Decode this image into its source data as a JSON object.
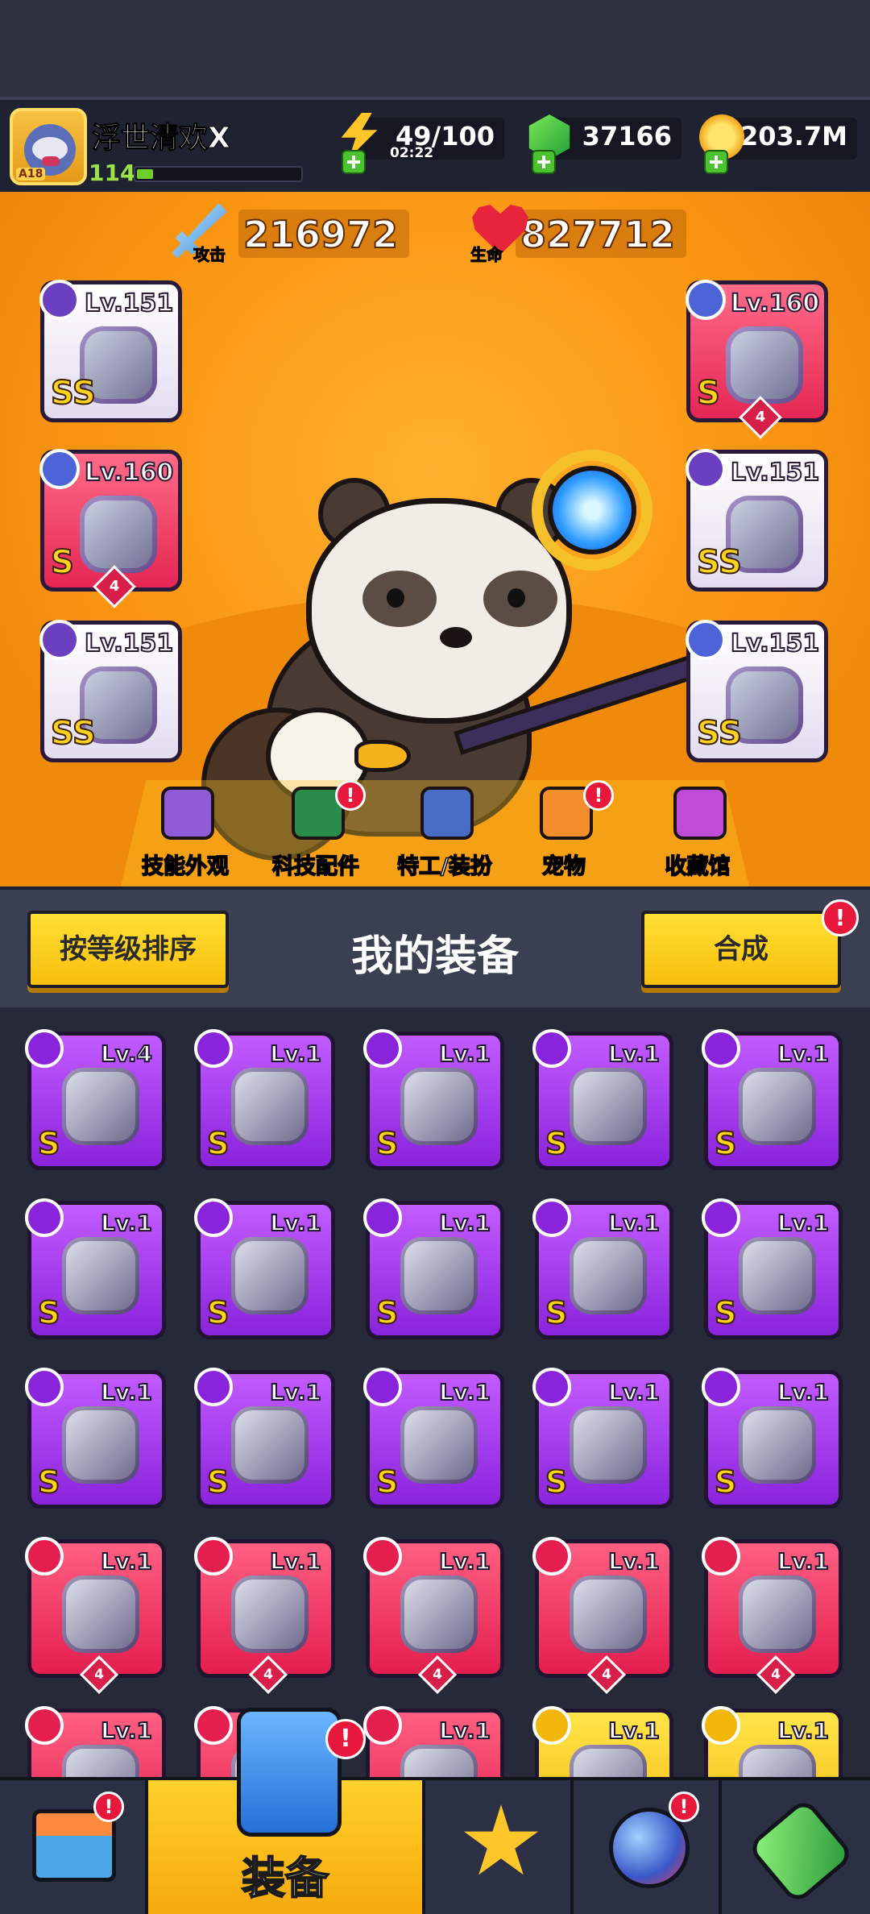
{
  "player": {
    "name": "浮世清欢X",
    "level": "114",
    "avatar_badge": "A18",
    "xp_fraction": 0.1
  },
  "resources": {
    "energy": {
      "value": "49/100",
      "timer": "02:22",
      "icon": "lightning-bolt-icon"
    },
    "gems": {
      "value": "37166",
      "icon": "green-gem-icon"
    },
    "coins": {
      "value": "203.7M",
      "icon": "gold-coin-icon"
    }
  },
  "stats": {
    "attack": {
      "label": "攻击",
      "value": "216972"
    },
    "health": {
      "label": "生命",
      "value": "827712"
    }
  },
  "equipped": [
    {
      "slot": "weapon",
      "level": "Lv.151",
      "rank": "SS",
      "rarity": "white"
    },
    {
      "slot": "necklace",
      "level": "Lv.160",
      "rank": "S",
      "rarity": "red",
      "stars": "4"
    },
    {
      "slot": "gloves",
      "level": "Lv.151",
      "rank": "SS",
      "rarity": "white"
    },
    {
      "slot": "armor",
      "level": "Lv.160",
      "rank": "S",
      "rarity": "red",
      "stars": "4"
    },
    {
      "slot": "belt",
      "level": "Lv.151",
      "rank": "SS",
      "rarity": "white"
    },
    {
      "slot": "boots",
      "level": "Lv.151",
      "rank": "SS",
      "rarity": "white"
    }
  ],
  "hero_menu": [
    {
      "label": "技能外观",
      "icon": "skill-skin-icon",
      "alert": false
    },
    {
      "label": "科技配件",
      "icon": "tech-part-icon",
      "alert": true
    },
    {
      "label": "特工/装扮",
      "icon": "agent-costume-icon",
      "alert": false
    },
    {
      "label": "宠物",
      "icon": "pet-icon",
      "alert": true
    },
    {
      "label": "收藏馆",
      "icon": "collection-icon",
      "alert": false
    }
  ],
  "equipment": {
    "sort_label": "按等级排序",
    "title": "我的装备",
    "merge_label": "合成",
    "alert": "!",
    "items": [
      {
        "level": "Lv.4",
        "rank": "S",
        "rarity": "purple"
      },
      {
        "level": "Lv.1",
        "rank": "S",
        "rarity": "purple"
      },
      {
        "level": "Lv.1",
        "rank": "S",
        "rarity": "purple"
      },
      {
        "level": "Lv.1",
        "rank": "S",
        "rarity": "purple"
      },
      {
        "level": "Lv.1",
        "rank": "S",
        "rarity": "purple"
      },
      {
        "level": "Lv.1",
        "rank": "S",
        "rarity": "purple"
      },
      {
        "level": "Lv.1",
        "rank": "S",
        "rarity": "purple"
      },
      {
        "level": "Lv.1",
        "rank": "S",
        "rarity": "purple"
      },
      {
        "level": "Lv.1",
        "rank": "S",
        "rarity": "purple"
      },
      {
        "level": "Lv.1",
        "rank": "S",
        "rarity": "purple"
      },
      {
        "level": "Lv.1",
        "rank": "S",
        "rarity": "purple"
      },
      {
        "level": "Lv.1",
        "rank": "S",
        "rarity": "purple"
      },
      {
        "level": "Lv.1",
        "rank": "S",
        "rarity": "purple"
      },
      {
        "level": "Lv.1",
        "rank": "S",
        "rarity": "purple"
      },
      {
        "level": "Lv.1",
        "rank": "S",
        "rarity": "purple"
      },
      {
        "level": "Lv.1",
        "rank": "",
        "rarity": "red",
        "stars": "4"
      },
      {
        "level": "Lv.1",
        "rank": "",
        "rarity": "red",
        "stars": "4"
      },
      {
        "level": "Lv.1",
        "rank": "",
        "rarity": "red",
        "stars": "4"
      },
      {
        "level": "Lv.1",
        "rank": "",
        "rarity": "red",
        "stars": "4"
      },
      {
        "level": "Lv.1",
        "rank": "",
        "rarity": "red",
        "stars": "4"
      },
      {
        "level": "Lv.1",
        "rank": "",
        "rarity": "red"
      },
      {
        "level": "",
        "rank": "",
        "rarity": "red"
      },
      {
        "level": "Lv.1",
        "rank": "",
        "rarity": "red"
      },
      {
        "level": "Lv.1",
        "rank": "",
        "rarity": "yellow"
      },
      {
        "level": "Lv.1",
        "rank": "",
        "rarity": "yellow"
      }
    ]
  },
  "nav": {
    "shop_icon": "shop-icon",
    "equip_label": "装备",
    "equip_icon": "equipment-icon",
    "battle_icon": "crossed-swords-star-icon",
    "world_icon": "globe-icon",
    "evolve_icon": "dna-capsule-icon",
    "alert": "!"
  }
}
